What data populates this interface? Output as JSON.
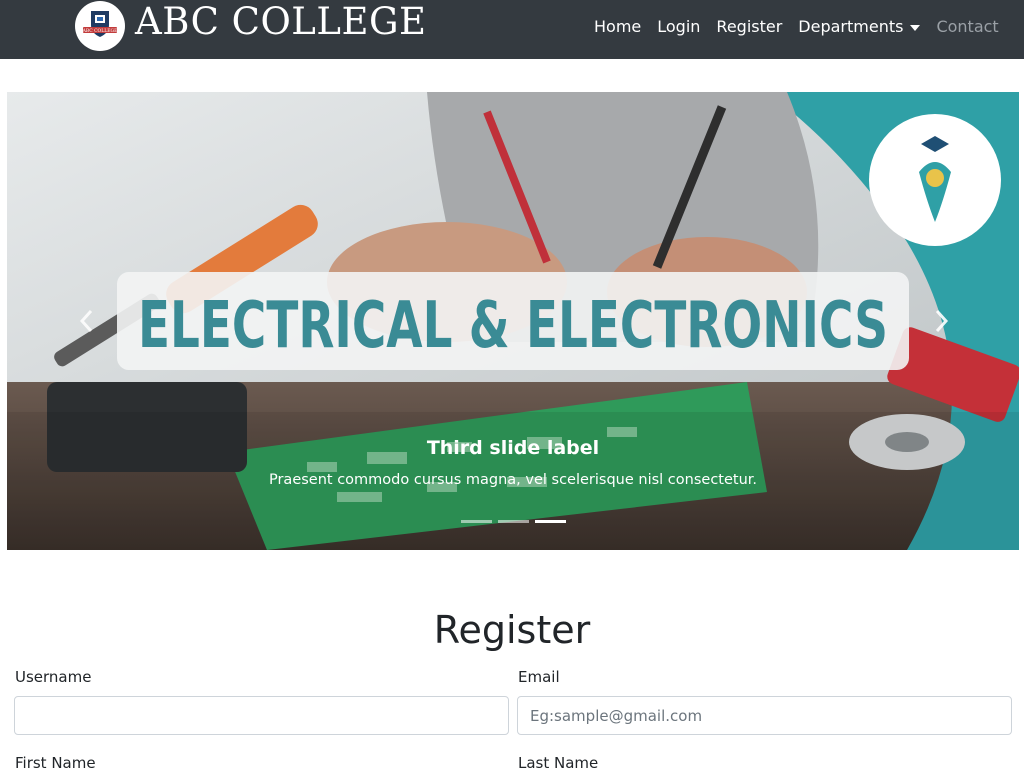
{
  "brand": {
    "name": "ABC COLLEGE",
    "logo_text": "ABC COLLEGE"
  },
  "nav": {
    "home": "Home",
    "login": "Login",
    "register": "Register",
    "departments": "Departments",
    "contact": "Contact"
  },
  "carousel": {
    "banner_text": "ELECTRICAL & ELECTRONICS",
    "caption_title": "Third slide label",
    "caption_text": "Praesent commodo cursus magna, vel scelerisque nisl consectetur.",
    "slide_count": 3,
    "active_slide": 3
  },
  "form": {
    "title": "Register",
    "username_label": "Username",
    "username_value": "",
    "email_label": "Email",
    "email_placeholder": "Eg:sample@gmail.com",
    "first_name_label": "First Name",
    "last_name_label": "Last Name"
  },
  "colors": {
    "navbar": "#343a40",
    "banner_text": "#3a8b95",
    "teal_accent": "#2ea3a8"
  }
}
